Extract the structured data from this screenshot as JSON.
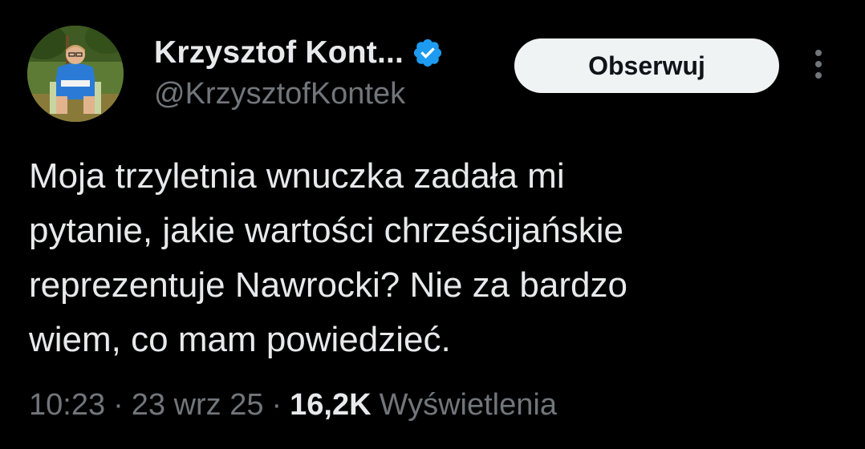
{
  "author": {
    "display_name": "Krzysztof Kont...",
    "handle": "@KrzysztofKontek",
    "verified": true,
    "verified_color": "#1d9bf0"
  },
  "actions": {
    "follow_label": "Obserwuj",
    "more_icon": "more-vertical-icon"
  },
  "tweet": {
    "text_lines": [
      "Moja trzyletnia wnuczka zadała mi",
      "pytanie, jakie wartości chrześcijańskie",
      "reprezentuje Nawrocki? Nie za bardzo",
      "wiem, co mam powiedzieć."
    ]
  },
  "meta": {
    "time": "10:23",
    "separator": "·",
    "date": "23 wrz 25",
    "views_count": "16,2K",
    "views_label": "Wyświetlenia"
  },
  "colors": {
    "background": "#000000",
    "primary_text": "#e7e9ea",
    "secondary_text": "#71767b",
    "button_bg": "#eff3f4",
    "button_text": "#0f1419"
  }
}
